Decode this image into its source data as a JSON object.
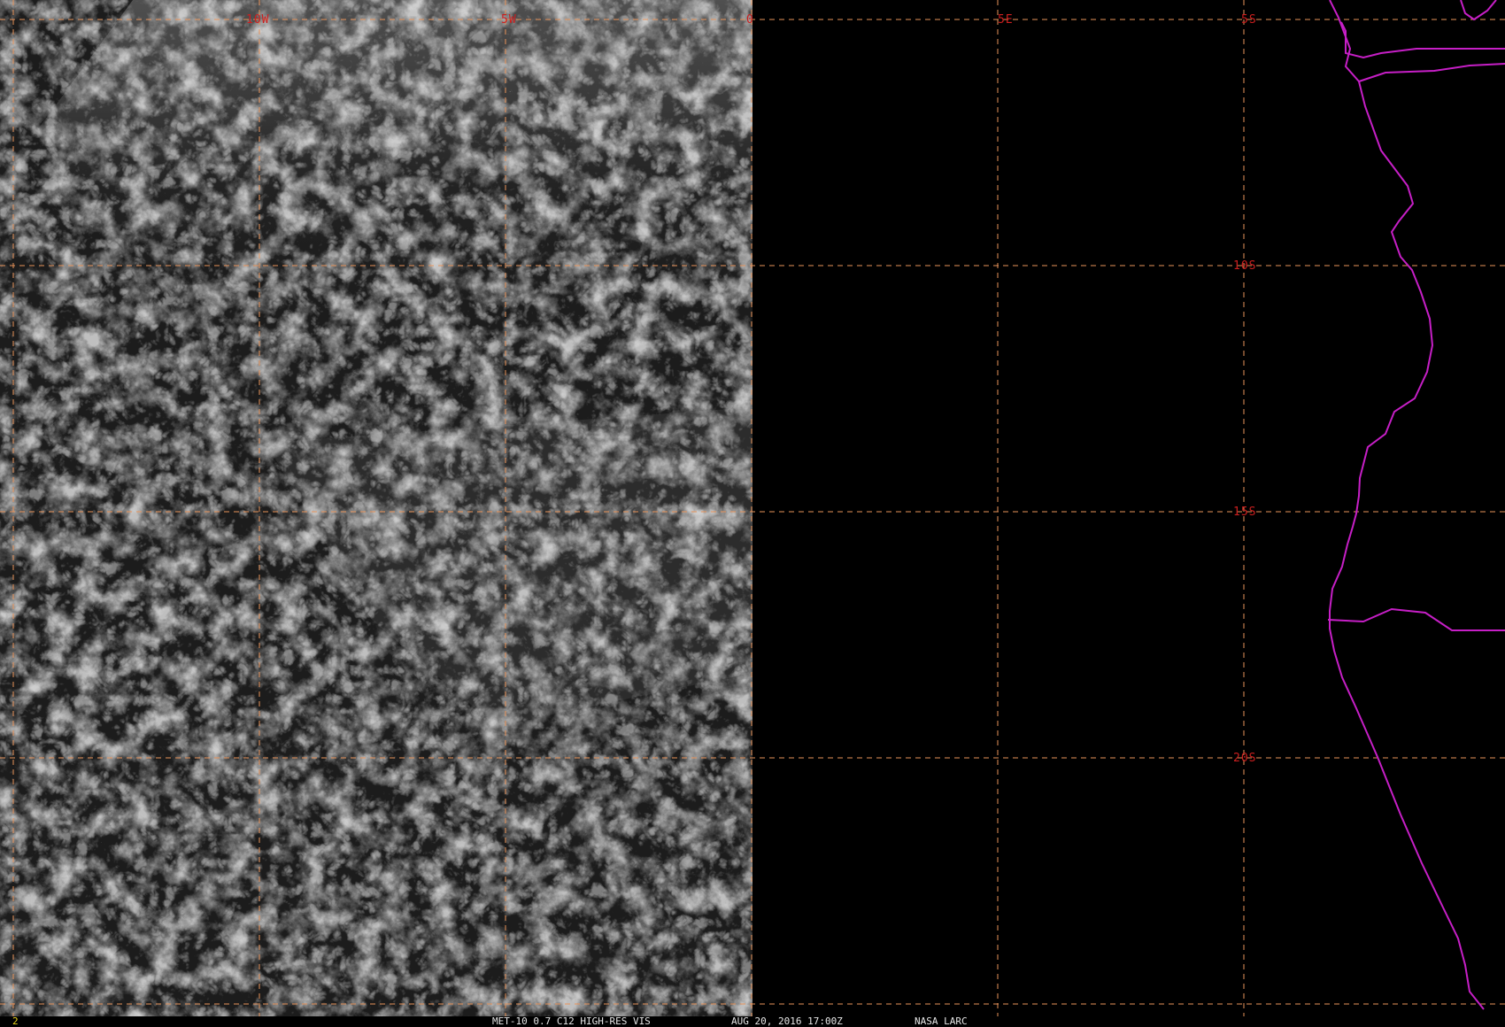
{
  "map": {
    "grid_color": "#e8935a",
    "label_color": "#cc1f1f",
    "coastline_color": "#c61fc6",
    "longitude_labels": [
      "10W",
      "5W",
      "0",
      "5E"
    ],
    "latitude_labels": [
      "5S",
      "10S",
      "15S",
      "20S"
    ]
  },
  "status": {
    "frame_number": "2",
    "product": "MET-10 0.7 C12 HIGH-RES VIS",
    "datetime": "AUG 20, 2016 17:00Z",
    "source": "NASA LARC"
  }
}
